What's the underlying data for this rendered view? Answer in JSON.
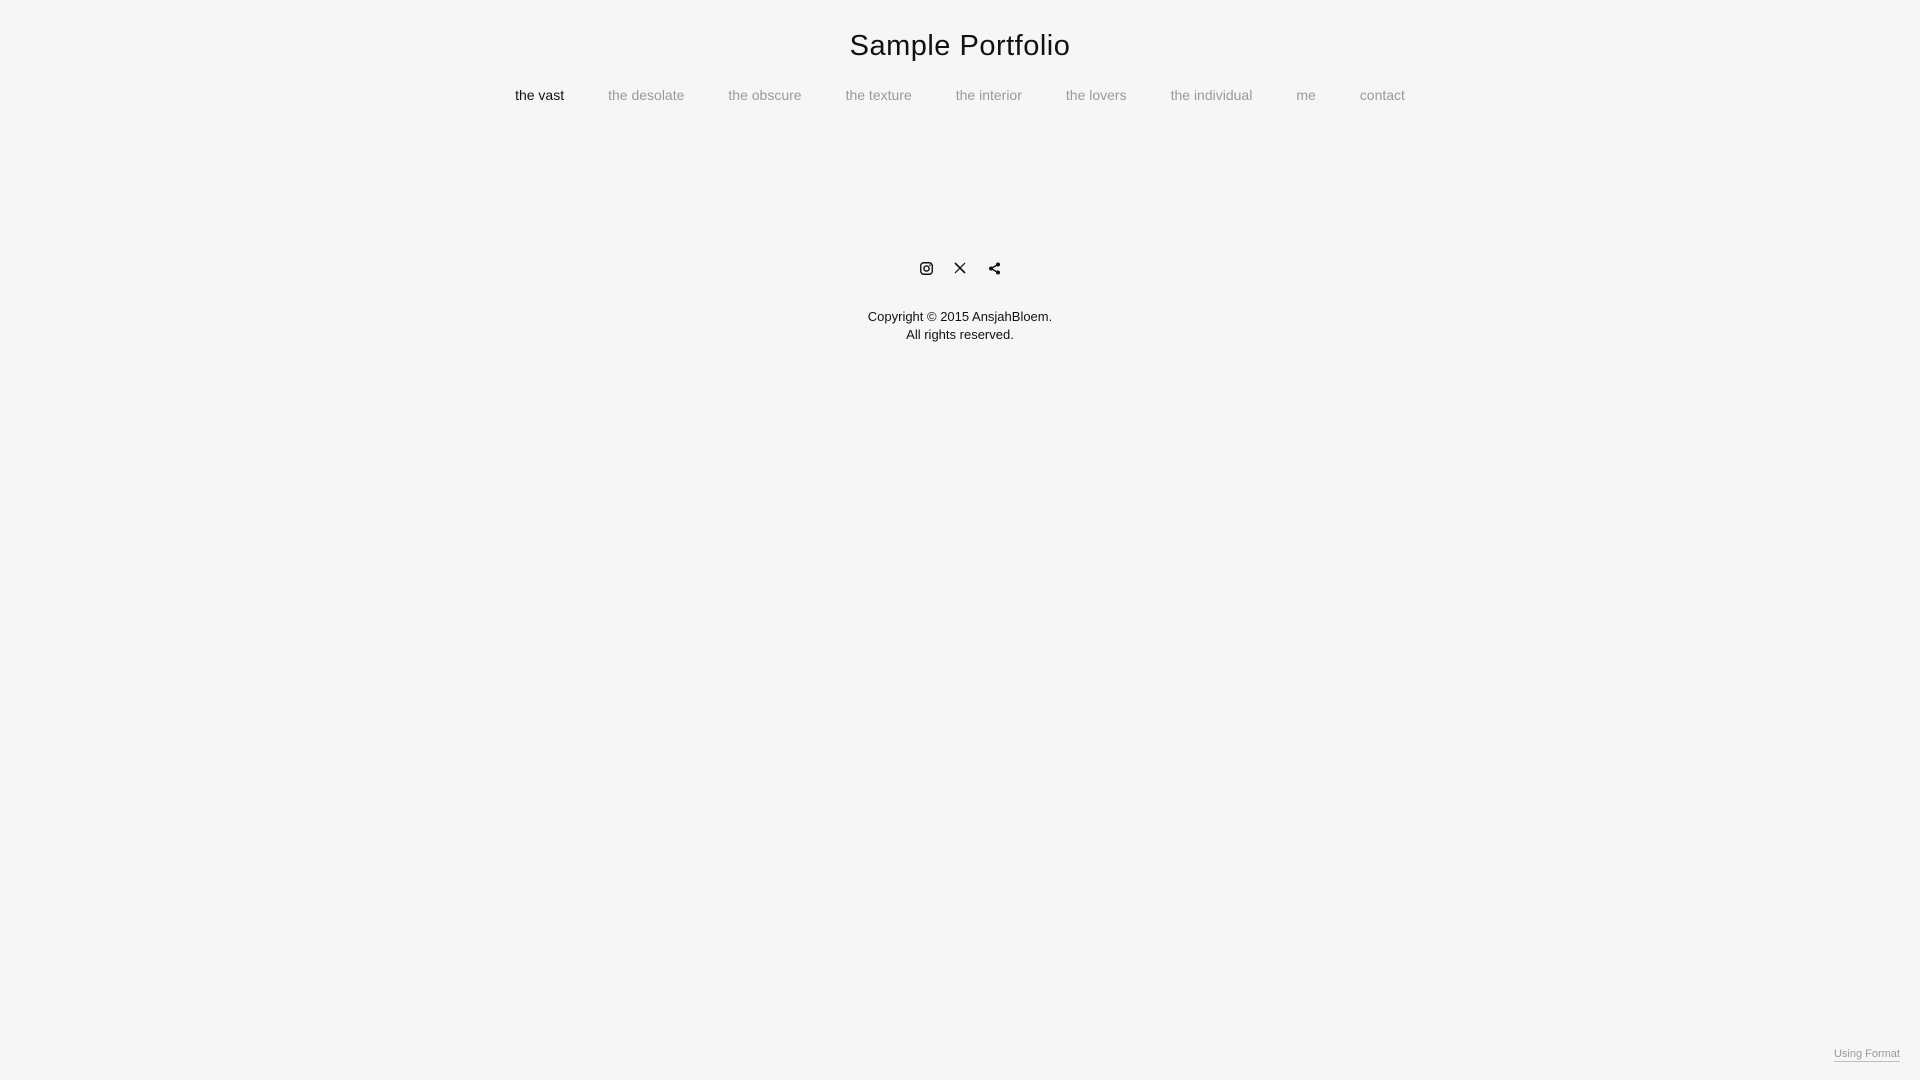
{
  "site": {
    "title": "Sample Portfolio"
  },
  "nav": {
    "items": [
      {
        "label": "the vast",
        "active": true
      },
      {
        "label": "the desolate",
        "active": false
      },
      {
        "label": "the obscure",
        "active": false
      },
      {
        "label": "the texture",
        "active": false
      },
      {
        "label": "the interior",
        "active": false
      },
      {
        "label": "the lovers",
        "active": false
      },
      {
        "label": "the individual",
        "active": false
      },
      {
        "label": "me",
        "active": false
      },
      {
        "label": "contact",
        "active": false
      }
    ]
  },
  "social": {
    "icons": [
      "instagram-icon",
      "x-icon",
      "share-icon"
    ]
  },
  "footer": {
    "copyright_line1": "Copyright © 2015 AnsjahBloem.",
    "copyright_line2": "All rights reserved.",
    "using_format": "Using Format"
  },
  "colors": {
    "background": "#f6f6f6",
    "text": "#111111",
    "muted": "#9a9a9a"
  }
}
